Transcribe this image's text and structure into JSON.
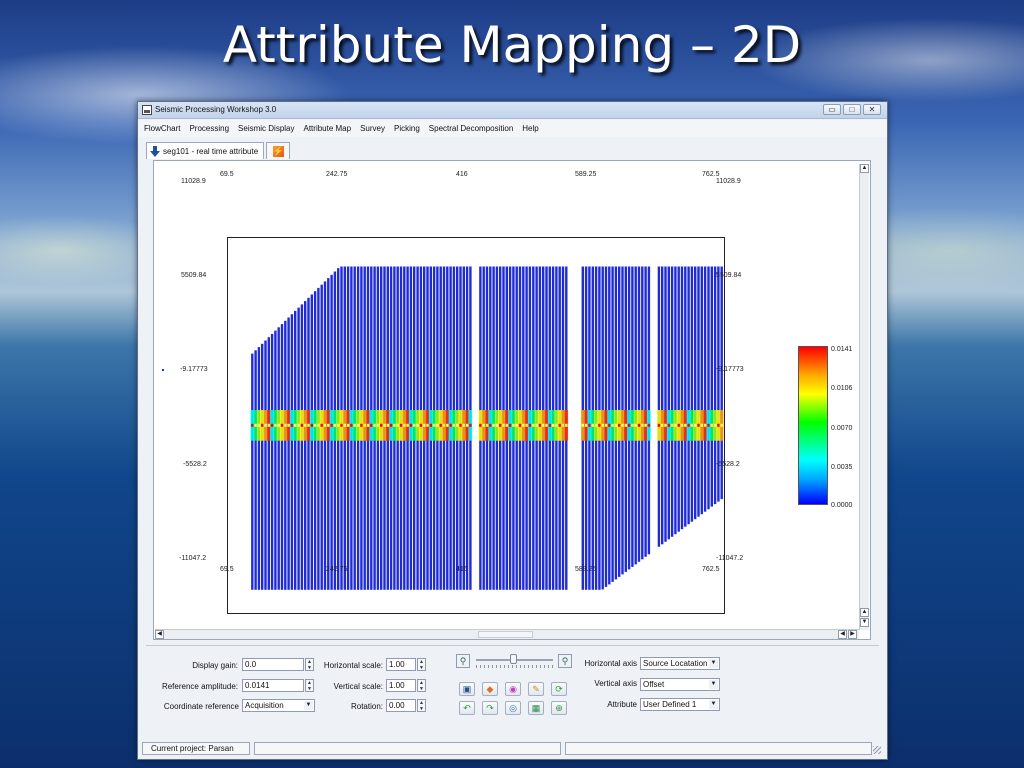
{
  "slide": {
    "title": "Attribute Mapping – 2D"
  },
  "window": {
    "title": "Seismic Processing Workshop 3.0",
    "controls": {
      "minimize": "▭",
      "maximize": "□",
      "close": "✕"
    }
  },
  "menubar": [
    "FlowChart",
    "Processing",
    "Seismic Display",
    "Attribute Map",
    "Survey",
    "Picking",
    "Spectral Decomposition",
    "Help"
  ],
  "tab": {
    "label": "seg101 - real time attribute",
    "icon": "download-arrow-icon"
  },
  "chart_data": {
    "type": "heatmap",
    "title": "",
    "xlabel": "",
    "ylabel": "",
    "xlim": [
      69.5,
      762.5
    ],
    "ylim": [
      -11047.2,
      11028.9
    ],
    "x_ticks": [
      "69.5",
      "242.75",
      "416",
      "589.25",
      "762.5"
    ],
    "y_ticks": [
      "11028.9",
      "5509.84",
      "-9.17773",
      "-5528.2",
      "-11047.2"
    ],
    "colorbar": {
      "min": 0.0,
      "max": 0.0141,
      "labels": [
        "0.0141",
        "0.0106",
        "0.0070",
        "0.0035",
        "0.0000"
      ],
      "colors": [
        "#ff0000",
        "#ffff00",
        "#00ff00",
        "#00ffff",
        "#0000ff"
      ]
    },
    "traces": {
      "x_start": 103,
      "x_end": 760,
      "spacing": 4.6,
      "gaps": [
        [
          410,
          420
        ],
        [
          542,
          562
        ],
        [
          659,
          665
        ]
      ],
      "y_bottom": -9630,
      "top_left": 4200,
      "top_ramp_end": 225,
      "top_flat": 9300,
      "bottom_flat_end": 590,
      "bottom_right": -4200
    },
    "high_band": {
      "y_center": 0,
      "half_width": 900,
      "peak_color": "#ff0000"
    }
  },
  "controls": {
    "display_gain": {
      "label": "Display gain:",
      "value": "0.0"
    },
    "reference_amplitude": {
      "label": "Reference amplitude:",
      "value": "0.0141"
    },
    "coordinate_reference": {
      "label": "Coordinate reference",
      "value": "Acquisition"
    },
    "horizontal_scale": {
      "label": "Horizontal scale:",
      "value": "1.00"
    },
    "vertical_scale": {
      "label": "Vertical scale:",
      "value": "1.00"
    },
    "rotation": {
      "label": "Rotation:",
      "value": "0.00"
    },
    "horizontal_axis": {
      "label": "Horizontal axis",
      "value": "Source Locatation"
    },
    "vertical_axis": {
      "label": "Vertical axis",
      "value": "Offset"
    },
    "attribute": {
      "label": "Attribute",
      "value": "User Defined 1"
    }
  },
  "toolbar_icons": [
    "image-icon",
    "layers-icon",
    "palette-icon",
    "pencil-icon",
    "refresh-icon",
    "undo-icon",
    "redo-icon",
    "globe-icon",
    "map-icon",
    "add-icon"
  ],
  "statusbar": {
    "project": "Current project:  Parsan"
  }
}
